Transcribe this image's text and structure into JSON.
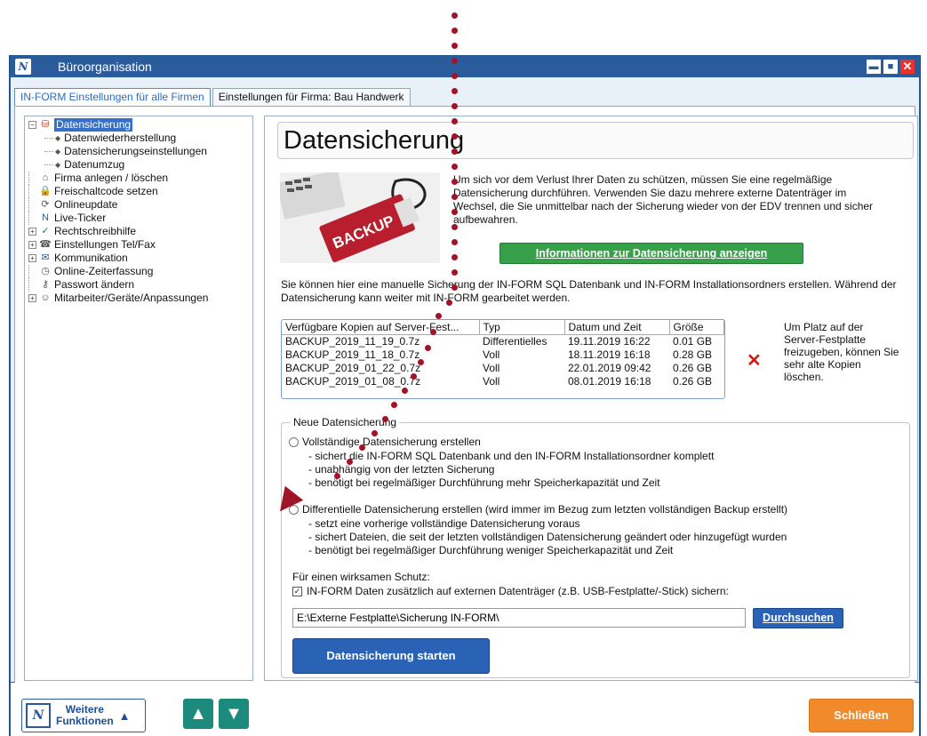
{
  "window": {
    "title": "Büroorganisation"
  },
  "tabs": [
    {
      "label": "IN-FORM Einstellungen für alle Firmen"
    },
    {
      "label": "Einstellungen für Firma: Bau Handwerk"
    }
  ],
  "tree": {
    "items": [
      {
        "label": "Datensicherung",
        "icon": "backup-icon",
        "expander": "−",
        "selected": true
      },
      {
        "label": "Datenwiederherstellung",
        "sub": true
      },
      {
        "label": "Datensicherungseinstellungen",
        "sub": true
      },
      {
        "label": "Datenumzug",
        "sub": true
      },
      {
        "label": "Firma anlegen / löschen",
        "icon": "company-icon"
      },
      {
        "label": "Freischaltcode setzen",
        "icon": "lock-icon"
      },
      {
        "label": "Onlineupdate",
        "icon": "update-icon"
      },
      {
        "label": "Live-Ticker",
        "icon": "ticker-icon"
      },
      {
        "label": "Rechtschreibhilfe",
        "icon": "check-icon",
        "expander": "+"
      },
      {
        "label": "Einstellungen Tel/Fax",
        "icon": "phone-icon",
        "expander": "+"
      },
      {
        "label": "Kommunikation",
        "icon": "mail-icon",
        "expander": "+"
      },
      {
        "label": "Online-Zeiterfassung",
        "icon": "time-icon"
      },
      {
        "label": "Passwort ändern",
        "icon": "key-icon"
      },
      {
        "label": "Mitarbeiter/Geräte/Anpassungen",
        "icon": "users-icon",
        "expander": "+"
      }
    ]
  },
  "content": {
    "heading": "Datensicherung",
    "image_text": "BACKUP",
    "intro": "Um sich vor dem Verlust Ihrer Daten zu schützen, müssen Sie eine regelmäßige Datensicherung durchführen. Verwenden Sie dazu mehrere externe Datenträger im Wechsel, die Sie unmittelbar nach der Sicherung wieder von der EDV trennen und sicher aufbewahren.",
    "info_button": "Informationen zur Datensicherung anzeigen",
    "manual_text": "Sie können hier eine manuelle Sicherung der IN-FORM SQL Datenbank und IN-FORM Installationsordners erstellen. Während der Datensicherung kann weiter mit IN-FORM gearbeitet werden.",
    "copies": {
      "headers": [
        "Verfügbare Kopien auf Server-Fest...",
        "Typ",
        "Datum und Zeit",
        "Größe"
      ],
      "rows": [
        [
          "BACKUP_2019_11_19_0.7z",
          "Differentielles",
          "19.11.2019 16:22",
          "0.01 GB"
        ],
        [
          "BACKUP_2019_11_18_0.7z",
          "Voll",
          "18.11.2019 16:18",
          "0.28 GB"
        ],
        [
          "BACKUP_2019_01_22_0.7z",
          "Voll",
          "22.01.2019 09:42",
          "0.26 GB"
        ],
        [
          "BACKUP_2019_01_08_0.7z",
          "Voll",
          "08.01.2019 16:18",
          "0.26 GB"
        ]
      ]
    },
    "delete_hint": "Um Platz auf der Server-Festplatte freizugeben, können Sie sehr alte Kopien löschen.",
    "new_backup": {
      "legend": "Neue Datensicherung",
      "full_label": "Vollständige Datensicherung erstellen",
      "full_bullets": [
        "- sichert die IN-FORM SQL Datenbank und den IN-FORM Installationsordner komplett",
        "- unabhängig von der letzten Sicherung",
        "- benötigt bei regelmäßiger Durchführung mehr Speicherkapazität und Zeit"
      ],
      "diff_label": "Differentielle Datensicherung erstellen (wird immer im Bezug zum letzten vollständigen Backup erstellt)",
      "diff_bullets": [
        "- setzt eine vorherige vollständige Datensicherung voraus",
        "- sichert Dateien, die seit der letzten vollständigen Datensicherung geändert oder hinzugefügt wurden",
        "- benötigt bei regelmäßiger Durchführung weniger Speicherkapazität und Zeit"
      ],
      "protect_label": "Für einen wirksamen Schutz:",
      "external_check": "IN-FORM Daten zusätzlich auf externen Datenträger (z.B. USB-Festplatte/-Stick) sichern:",
      "path_value": "E:\\Externe Festplatte\\Sicherung IN-FORM\\",
      "browse_button": "Durchsuchen",
      "start_button": "Datensicherung starten"
    }
  },
  "footer": {
    "more_line1": "Weitere",
    "more_line2": "Funktionen",
    "close_button": "Schließen"
  },
  "colors": {
    "titlebar": "#2a5c9c",
    "green_button": "#37a04a",
    "blue_button": "#2a63b5",
    "orange_button": "#f08a2a",
    "teal_button": "#1c8a7c",
    "annotation": "#a01428"
  }
}
